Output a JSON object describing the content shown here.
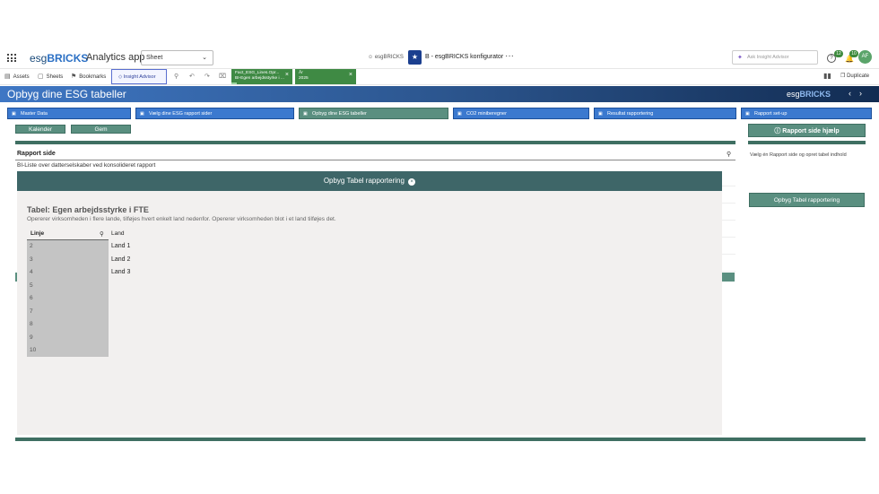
{
  "header": {
    "logo_prefix": "esg",
    "logo_bold": "BRICKS",
    "app_type": "Analytics app",
    "sheet_select": "Sheet",
    "space_owner": "esgBRICKS",
    "app_name": "B - esgBRICKS konfigurator",
    "more": "···",
    "ask_placeholder": "Ask Insight Advisor",
    "help_count": "12",
    "notif_count": "10",
    "avatar_initials": "AF"
  },
  "toolbar": {
    "assets": "Assets",
    "sheets": "Sheets",
    "bookmarks": "Bookmarks",
    "insight_advisor": "Insight Advisor",
    "duplicate": "Duplicate",
    "chips": [
      {
        "title": "Fact_ESG_Lines.Opr...",
        "value": "BI-Egen arbejdsstyrke i ..."
      },
      {
        "title": "År",
        "value": "2025"
      }
    ]
  },
  "banner": {
    "title": "Opbyg dine ESG tabeller",
    "logo_prefix": "esg",
    "logo_bold": "BRICKS"
  },
  "nav": [
    {
      "label": "Master Data",
      "style": "blue"
    },
    {
      "label": "Vælg dine ESG rapport sider",
      "style": "blue"
    },
    {
      "label": "Opbyg dine ESG tabeller",
      "style": "teal"
    },
    {
      "label": "CO2 miniberegner",
      "style": "blue"
    },
    {
      "label": "Resultat rapportering",
      "style": "blue"
    },
    {
      "label": "Rapport set-up",
      "style": "blue"
    }
  ],
  "actions": {
    "kalender": "Kalender",
    "gem": "Gem",
    "help": "Rapport side hjælp"
  },
  "rapport": {
    "label": "Rapport side",
    "selected_item": "BI-Liste over datterselskaber ved konsolideret rapport"
  },
  "side": {
    "instruction": "Vælg én Rapport side og opret tabel indhold",
    "button": "Opbyg Tabel rapportering"
  },
  "dialog": {
    "header": "Opbyg Tabel rapportering",
    "table_title": "Tabel: Egen arbejdsstyrke i FTE",
    "table_desc": "Opererer virksomheden i flere lande, tilføjes hvert enkelt land nedenfor. Opererer virksomheden blot i et land tilføjes det.",
    "col_linje": "Linje",
    "col_land": "Land",
    "linje_rows": [
      "2",
      "3",
      "4",
      "5",
      "6",
      "7",
      "8",
      "9",
      "10"
    ],
    "land_rows": [
      "Land 1",
      "Land 2",
      "Land 3"
    ]
  }
}
